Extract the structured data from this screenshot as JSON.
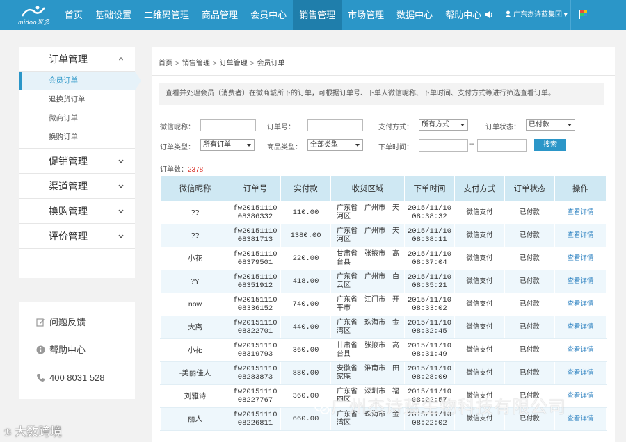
{
  "brand": {
    "logo_text": "midoo米多"
  },
  "nav": {
    "items": [
      "首页",
      "基础设置",
      "二维码管理",
      "商品管理",
      "会员中心",
      "销售管理",
      "市场管理",
      "数据中心",
      "帮助中心"
    ],
    "active_index": 5,
    "user_label": "广东杰诗蓝集团"
  },
  "sidebar": {
    "groups": [
      {
        "label": "订单管理",
        "expanded": true,
        "subitems": [
          "会员订单",
          "退换货订单",
          "微商订单",
          "换购订单"
        ],
        "active_sub": 0
      },
      {
        "label": "促销管理",
        "expanded": false
      },
      {
        "label": "渠道管理",
        "expanded": false
      },
      {
        "label": "换购管理",
        "expanded": false
      },
      {
        "label": "评价管理",
        "expanded": false
      }
    ],
    "help": [
      {
        "icon": "edit-icon",
        "label": "问题反馈"
      },
      {
        "icon": "info-icon",
        "label": "帮助中心"
      },
      {
        "icon": "phone-icon",
        "label": "400 8031 528"
      }
    ]
  },
  "breadcrumb": [
    "首页",
    "销售管理",
    "订单管理",
    "会员订单"
  ],
  "tip": "查看并处理会员（消费者）在微商城所下的订单，可根据订单号、下单人微信昵称、下单时间、支付方式等进行筛选查看订单。",
  "filters": {
    "nickname_label": "微信昵称：",
    "order_no_label": "订单号：",
    "pay_method_label": "支付方式：",
    "pay_method_value": "所有方式",
    "status_label": "订单状态：",
    "status_value": "已付款",
    "order_type_label": "订单类型：",
    "order_type_value": "所有订单",
    "goods_type_label": "商品类型：",
    "goods_type_value": "全部类型",
    "time_label": "下单时间：",
    "time_sep": "--",
    "search_label": "搜索"
  },
  "summary": {
    "label": "订单数：",
    "count": "2378"
  },
  "table": {
    "headers": [
      "微信昵称",
      "订单号",
      "实付款",
      "收货区域",
      "下单时间",
      "支付方式",
      "订单状态",
      "操作"
    ],
    "rows": [
      {
        "nick": "??",
        "order_a": "fw20151110",
        "order_b": "08386332",
        "amount": "110.00",
        "region": "广东省　广州市　天河区",
        "date": "2015/11/10",
        "time": "08:38:32",
        "pay": "微信支付",
        "status": "已付款",
        "action": "查看详情"
      },
      {
        "nick": "??",
        "order_a": "fw20151110",
        "order_b": "08381713",
        "amount": "1380.00",
        "region": "广东省　广州市　天河区",
        "date": "2015/11/10",
        "time": "08:38:11",
        "pay": "微信支付",
        "status": "已付款",
        "action": "查看详情"
      },
      {
        "nick": "小花",
        "order_a": "fw20151110",
        "order_b": "08379501",
        "amount": "220.00",
        "region": "甘肃省　张掖市　高台县",
        "date": "2015/11/10",
        "time": "08:37:04",
        "pay": "微信支付",
        "status": "已付款",
        "action": "查看详情"
      },
      {
        "nick": "?Y",
        "order_a": "fw20151110",
        "order_b": "08351912",
        "amount": "418.00",
        "region": "广东省　广州市　白云区",
        "date": "2015/11/10",
        "time": "08:35:21",
        "pay": "微信支付",
        "status": "已付款",
        "action": "查看详情"
      },
      {
        "nick": "now",
        "order_a": "fw20151110",
        "order_b": "08336152",
        "amount": "740.00",
        "region": "广东省　江门市　开平市",
        "date": "2015/11/10",
        "time": "08:33:02",
        "pay": "微信支付",
        "status": "已付款",
        "action": "查看详情"
      },
      {
        "nick": "大离",
        "order_a": "fw20151110",
        "order_b": "08322701",
        "amount": "440.00",
        "region": "广东省　珠海市　金湾区",
        "date": "2015/11/10",
        "time": "08:32:45",
        "pay": "微信支付",
        "status": "已付款",
        "action": "查看详情"
      },
      {
        "nick": "小花",
        "order_a": "fw20151110",
        "order_b": "08319793",
        "amount": "360.00",
        "region": "甘肃省　张掖市　高台县",
        "date": "2015/11/10",
        "time": "08:31:49",
        "pay": "微信支付",
        "status": "已付款",
        "action": "查看详情"
      },
      {
        "nick": "-美丽佳人",
        "order_a": "fw20151110",
        "order_b": "08283873",
        "amount": "880.00",
        "region": "安徽省　淮南市　田家庵",
        "date": "2015/11/10",
        "time": "08:28:00",
        "pay": "微信支付",
        "status": "已付款",
        "action": "查看详情"
      },
      {
        "nick": "刘雅诗",
        "order_a": "fw20151110",
        "order_b": "08227767",
        "amount": "360.00",
        "region": "广东省　深圳市　福田区",
        "date": "2015/11/10",
        "time": "08:22:57",
        "pay": "微信支付",
        "status": "已付款",
        "action": "查看详情"
      },
      {
        "nick": "丽人",
        "order_a": "fw20151110",
        "order_b": "08226811",
        "amount": "660.00",
        "region": "广东省　珠海市　金湾区",
        "date": "2015/11/10",
        "time": "08:22:02",
        "pay": "微信支付",
        "status": "已付款",
        "action": "查看详情"
      }
    ]
  },
  "watermarks": {
    "company": "广州杰诗蓝生物科技有限公司",
    "source": "大数跨境"
  },
  "colors": {
    "nav_bg": "#2b96c8",
    "nav_active": "#1f7eab",
    "table_header": "#cfe8f3",
    "count_red": "#d9342b",
    "link": "#2b80c0"
  }
}
